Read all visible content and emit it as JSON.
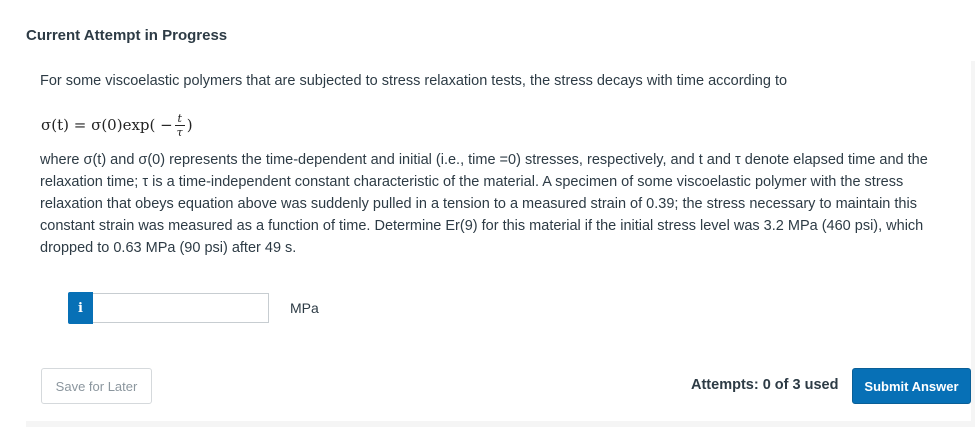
{
  "header": {
    "title": "Current Attempt in Progress"
  },
  "question": {
    "intro": "For some viscoelastic polymers that are subjected to stress relaxation tests, the stress decays with time according to",
    "equation": {
      "lhs": "σ(t) = σ(0)exp( −",
      "frac_numerator": "t",
      "frac_denominator": "τ",
      "close": ")"
    },
    "body": "where σ(t) and σ(0) represents the time-dependent and initial (i.e., time =0) stresses, respectively, and t and τ denote elapsed time and the relaxation time; τ is a time-independent constant characteristic of the material. A specimen of some viscoelastic polymer with the stress relaxation that obeys equation above was suddenly pulled in a tension to a measured strain of 0.39; the stress necessary to maintain this constant strain was measured as a function of time. Determine Er(9) for this material if the initial stress level was 3.2 MPa (460 psi), which dropped to 0.63 MPa (90 psi) after 49 s."
  },
  "answer": {
    "info_icon": "i",
    "value": "",
    "unit": "MPa"
  },
  "footer": {
    "save_label": "Save for Later",
    "attempts_text": "Attempts: 0 of 3 used",
    "submit_label": "Submit Answer"
  },
  "colors": {
    "accent": "#0770b6"
  }
}
